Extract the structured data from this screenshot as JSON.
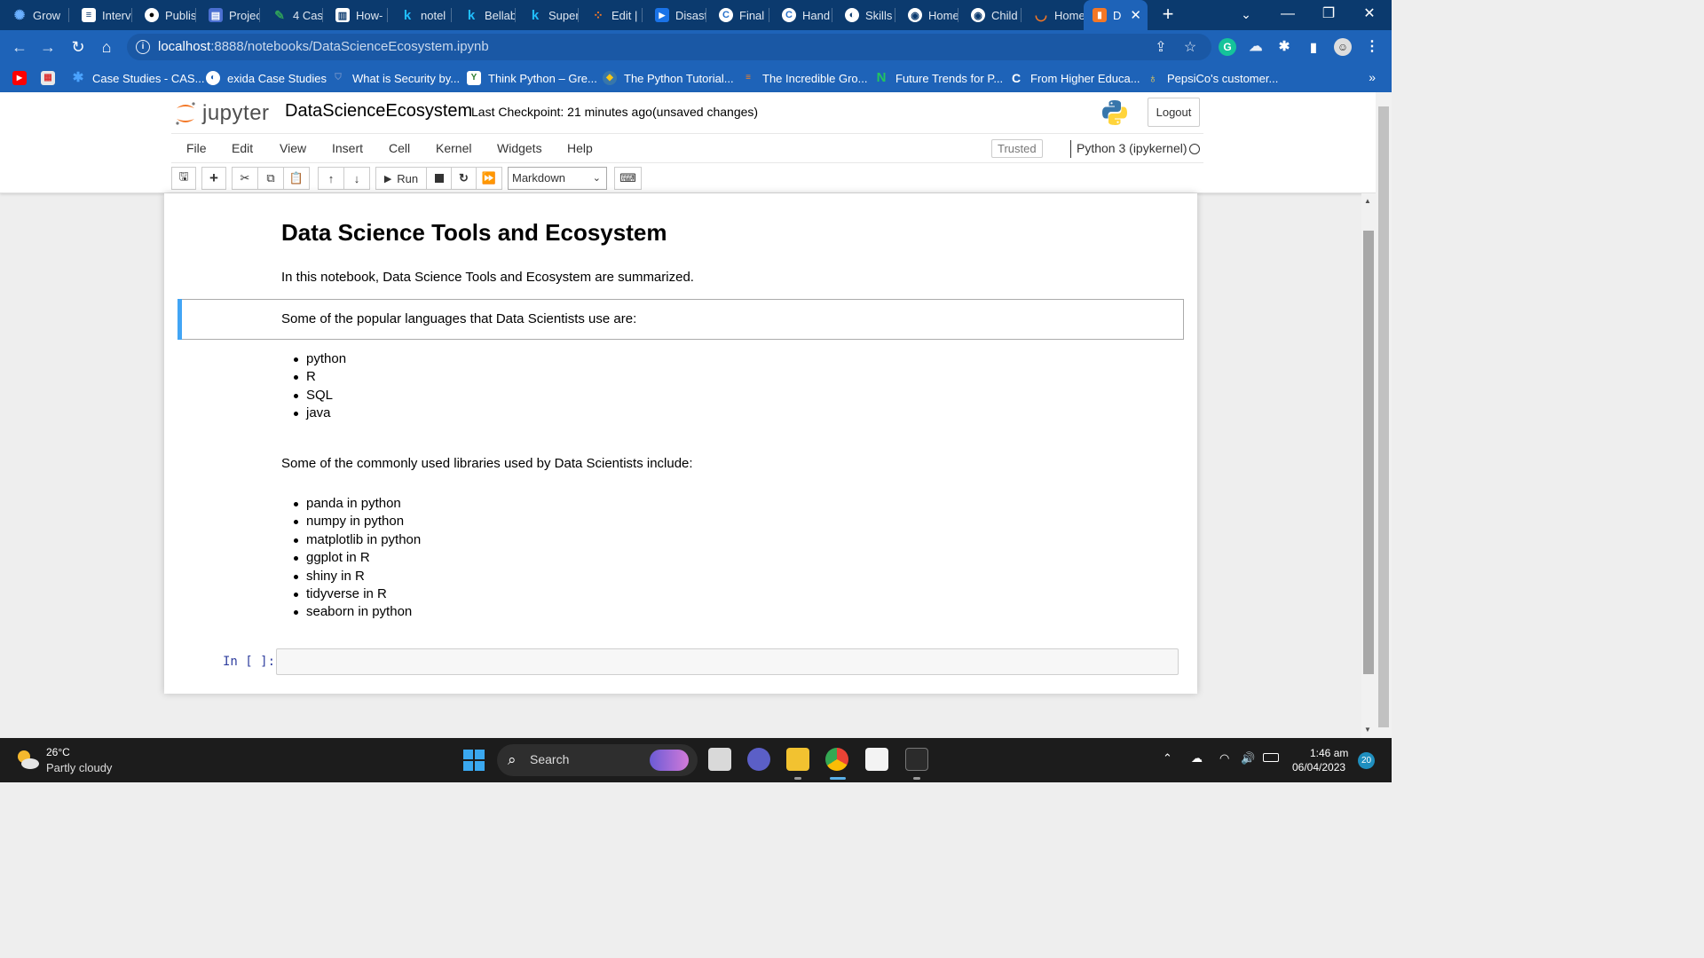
{
  "browser": {
    "tabs": [
      {
        "label": "Grow",
        "icon": "gear-icon",
        "color": "#6ab0ff"
      },
      {
        "label": "Interv",
        "icon": "document-icon",
        "color": "#ffffff"
      },
      {
        "label": "Publis",
        "icon": "medium-icon",
        "color": "#000000"
      },
      {
        "label": "Projec",
        "icon": "board-icon",
        "color": "#4a6fd1"
      },
      {
        "label": "4 Cas",
        "icon": "pen-icon",
        "color": "#2e9e5a"
      },
      {
        "label": "How-",
        "icon": "board-icon",
        "color": "#ffffff"
      },
      {
        "label": "notel",
        "icon": "k-icon",
        "color": "#20beff"
      },
      {
        "label": "Bellab",
        "icon": "k-icon",
        "color": "#20beff"
      },
      {
        "label": "Super",
        "icon": "k-icon",
        "color": "#20beff"
      },
      {
        "label": "Edit |",
        "icon": "dots-icon",
        "color": "#f37726"
      },
      {
        "label": "Disast",
        "icon": "play-icon",
        "color": "#1a73e8"
      },
      {
        "label": "Final",
        "icon": "coursera-icon",
        "color": "#2a73cc"
      },
      {
        "label": "Hand",
        "icon": "coursera-icon",
        "color": "#2a73cc"
      },
      {
        "label": "Skills",
        "icon": "globe-icon",
        "color": "#ffffff"
      },
      {
        "label": "Home",
        "icon": "github-icon",
        "color": "#ffffff"
      },
      {
        "label": "Child",
        "icon": "github-icon",
        "color": "#ffffff"
      },
      {
        "label": "Home",
        "icon": "jupyter-icon",
        "color": "#f37726"
      },
      {
        "label": "D",
        "icon": "notebook-icon",
        "color": "#f37726",
        "active": true
      }
    ],
    "new_tab": "+",
    "window": {
      "minimize": "—",
      "restore": "❐",
      "close": "✕",
      "dropdown": "⌄"
    },
    "url": {
      "host": "localhost",
      "path": ":8888/notebooks/DataScienceEcosystem.ipynb"
    },
    "bookmarks": [
      {
        "label": "",
        "icon": "youtube-icon",
        "color": "#ff0000"
      },
      {
        "label": "",
        "icon": "store-icon",
        "color": "#e8e8e8"
      },
      {
        "label": "Case Studies - CAS...",
        "icon": "star-icon",
        "color": "#4aa3ff"
      },
      {
        "label": "exida Case Studies",
        "icon": "globe-icon",
        "color": "#ffffff"
      },
      {
        "label": "What is Security by...",
        "icon": "shield-icon",
        "color": "#6a8fc8"
      },
      {
        "label": "Think Python – Gre...",
        "icon": "book-icon",
        "color": "#ffffff"
      },
      {
        "label": "The Python Tutorial...",
        "icon": "python-icon",
        "color": "#f5c518"
      },
      {
        "label": "The Incredible Gro...",
        "icon": "stack-icon",
        "color": "#f48024"
      },
      {
        "label": "Future Trends for P...",
        "icon": "n-icon",
        "color": "#22c55e"
      },
      {
        "label": "From Higher Educa...",
        "icon": "coursera-icon",
        "color": "#ffffff"
      },
      {
        "label": "PepsiCo's customer...",
        "icon": "pin-icon",
        "color": "#ffd54f"
      }
    ],
    "bookmarks_more": "»"
  },
  "jupyter": {
    "logo_word": "jupyter",
    "notebook_name": "DataScienceEcosystem",
    "checkpoint": "Last Checkpoint: 21 minutes ago",
    "autosave": "(unsaved changes)",
    "logout": "Logout",
    "menus": [
      "File",
      "Edit",
      "View",
      "Insert",
      "Cell",
      "Kernel",
      "Widgets",
      "Help"
    ],
    "trusted": "Trusted",
    "kernel": "Python 3 (ipykernel)",
    "toolbar": {
      "run": "Run",
      "cell_type": "Markdown"
    }
  },
  "notebook": {
    "heading": "Data Science Tools and Ecosystem",
    "intro": "In this notebook, Data Science Tools and Ecosystem are summarized.",
    "languages_intro": "Some of the popular languages that Data Scientists use are:",
    "languages": [
      "python",
      "R",
      "SQL",
      "java"
    ],
    "libraries_intro": "Some of the commonly used libraries used by Data Scientists include:",
    "libraries": [
      "panda in python",
      "numpy in python",
      "matplotlib in python",
      "ggplot in R",
      "shiny in R",
      "tidyverse in R",
      "seaborn in python"
    ],
    "prompt": "In [ ]:"
  },
  "taskbar": {
    "temperature": "26°C",
    "weather": "Partly cloudy",
    "search": "Search",
    "time": "1:46 am",
    "date": "06/04/2023",
    "notifications": "20"
  }
}
